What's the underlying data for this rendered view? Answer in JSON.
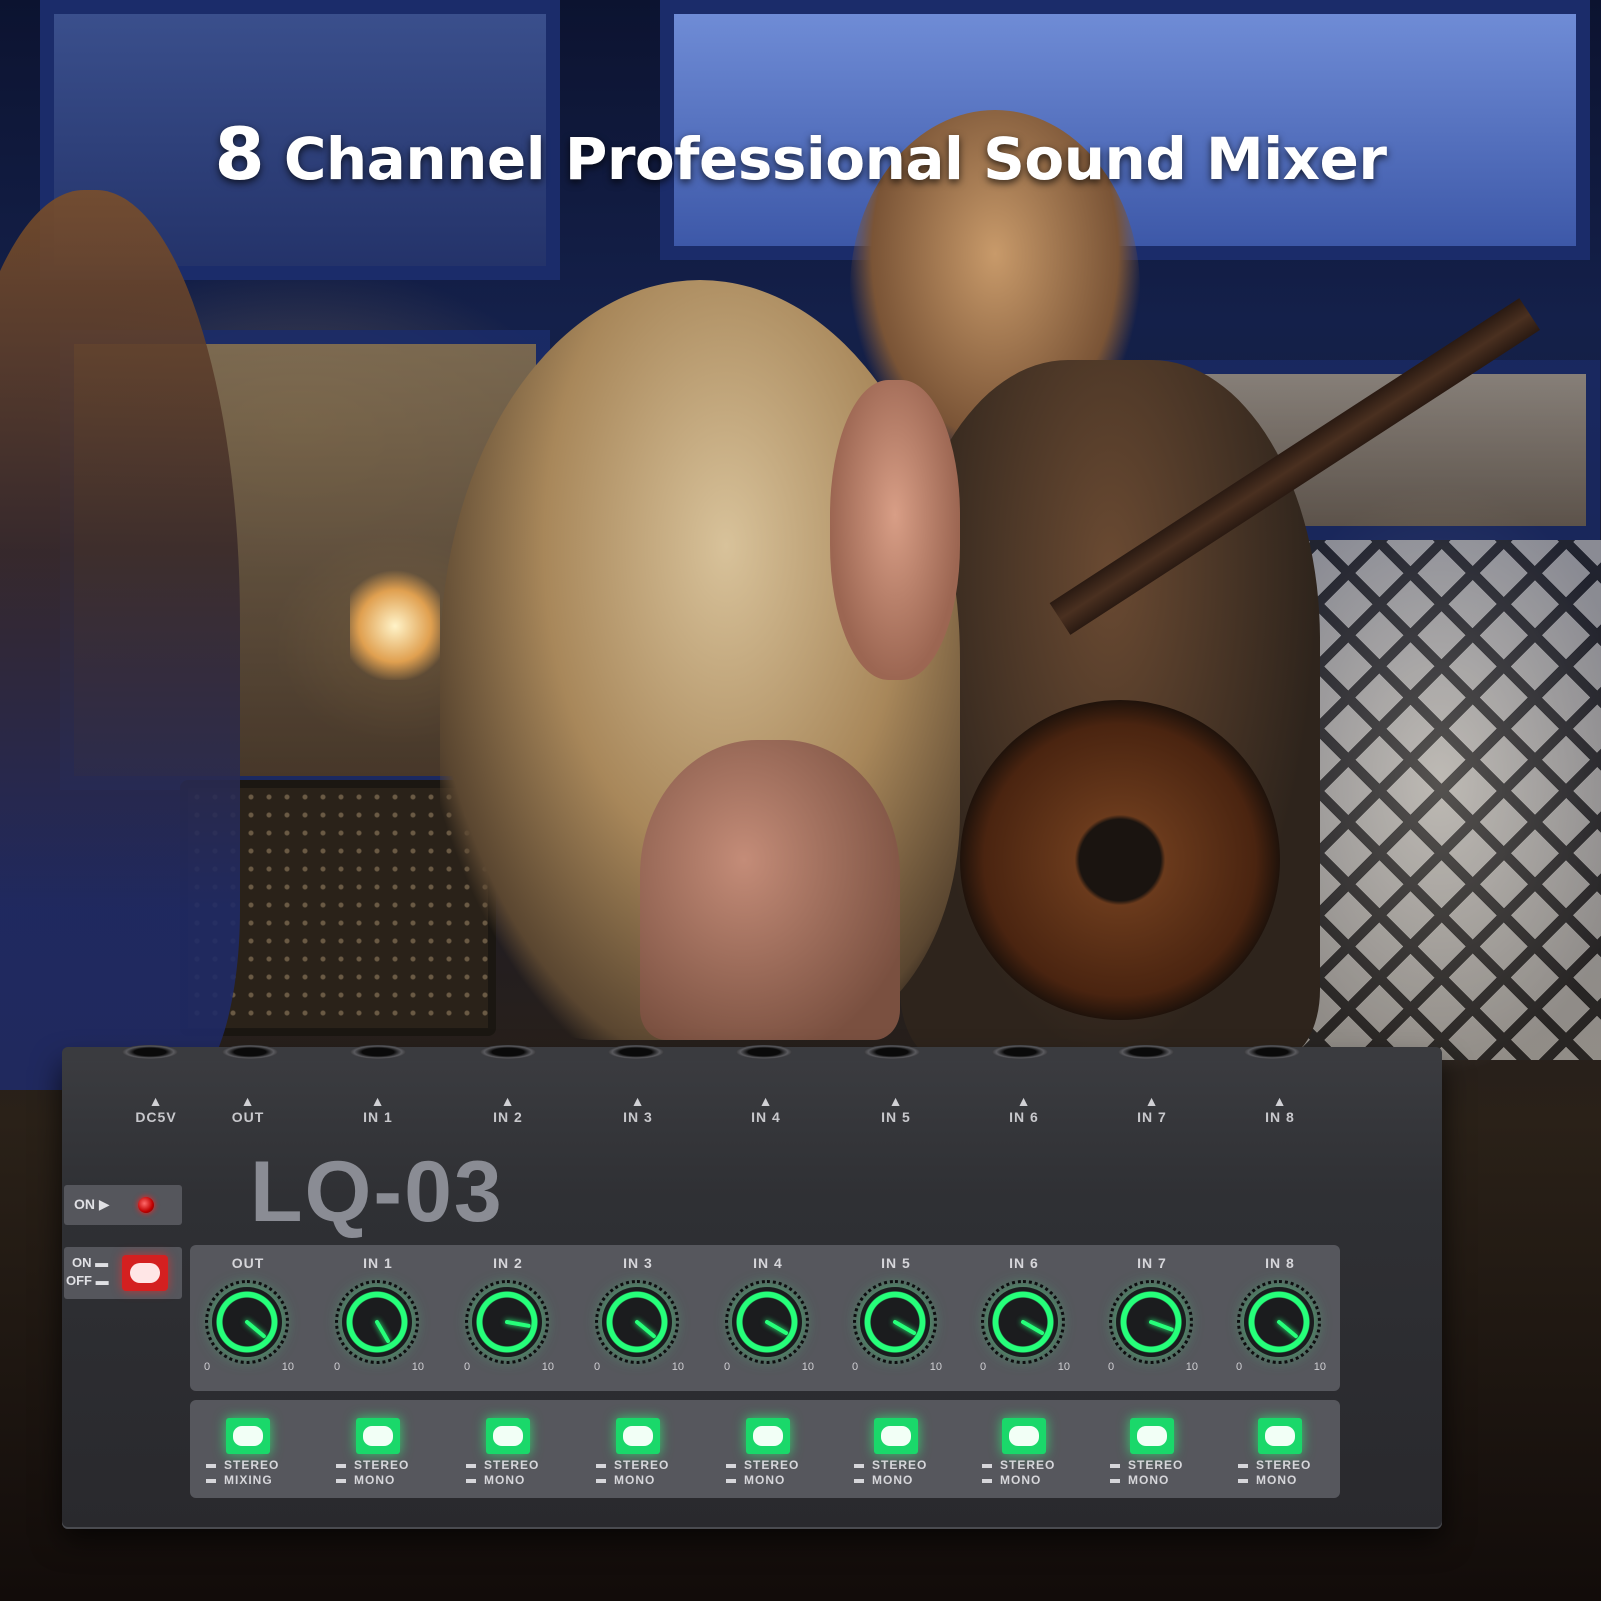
{
  "headline": {
    "number": "8",
    "text": "Channel Professional Sound Mixer"
  },
  "device": {
    "model": "LQ-03",
    "ports": [
      "DC5V",
      "OUT",
      "IN 1",
      "IN 2",
      "IN 3",
      "IN 4",
      "IN 5",
      "IN 6",
      "IN 7",
      "IN 8"
    ],
    "on_indicator_label": "ON ▶",
    "power_switch": {
      "on_label": "ON ▬",
      "off_label": "OFF ▬"
    },
    "knobs": [
      {
        "label": "OUT",
        "min": "0",
        "max": "10"
      },
      {
        "label": "IN 1",
        "min": "0",
        "max": "10"
      },
      {
        "label": "IN 2",
        "min": "0",
        "max": "10"
      },
      {
        "label": "IN 3",
        "min": "0",
        "max": "10"
      },
      {
        "label": "IN 4",
        "min": "0",
        "max": "10"
      },
      {
        "label": "IN 5",
        "min": "0",
        "max": "10"
      },
      {
        "label": "IN 6",
        "min": "0",
        "max": "10"
      },
      {
        "label": "IN 7",
        "min": "0",
        "max": "10"
      },
      {
        "label": "IN 8",
        "min": "0",
        "max": "10"
      }
    ],
    "mode_buttons": [
      {
        "line1": "STEREO",
        "line2": "MIXING"
      },
      {
        "line1": "STEREO",
        "line2": "MONO"
      },
      {
        "line1": "STEREO",
        "line2": "MONO"
      },
      {
        "line1": "STEREO",
        "line2": "MONO"
      },
      {
        "line1": "STEREO",
        "line2": "MONO"
      },
      {
        "line1": "STEREO",
        "line2": "MONO"
      },
      {
        "line1": "STEREO",
        "line2": "MONO"
      },
      {
        "line1": "STEREO",
        "line2": "MONO"
      },
      {
        "line1": "STEREO",
        "line2": "MONO"
      }
    ],
    "colors": {
      "knob_glow": "#26ff7a",
      "button_glow": "#1ad86a",
      "power_led": "#d42020"
    }
  }
}
